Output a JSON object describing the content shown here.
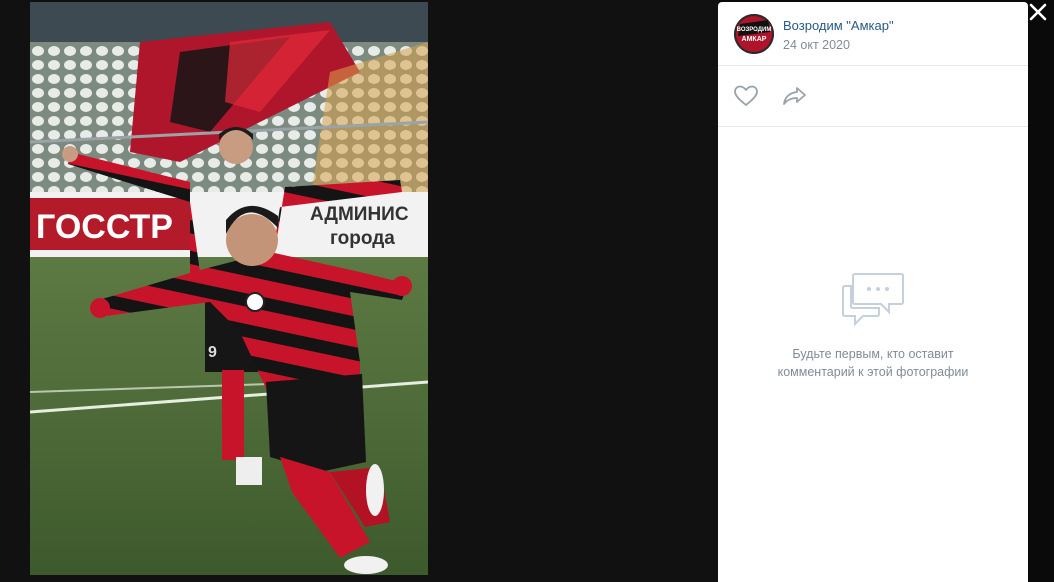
{
  "viewer": {
    "photo": {
      "alt_icon": "photo"
    },
    "close_icon": "close-icon"
  },
  "sidebar": {
    "author": {
      "name": "Возродим \"Амкар\"",
      "avatar_text": "ВОЗРОДИМ АМКАР"
    },
    "date": "24 окт 2020",
    "actions": {
      "like_icon": "heart-icon",
      "share_icon": "share-icon"
    },
    "comments": {
      "empty_icon": "chat-bubble-icon",
      "empty_text": "Будьте первым, кто оставит комментарий к этой фотографии"
    }
  },
  "photo_texts": {
    "banner_left": "ГОССТР",
    "banner_right_1": "АДМИНИС",
    "banner_right_2": "города",
    "shorts_number": "9"
  },
  "colors": {
    "link": "#2a5885",
    "muted": "#818c99",
    "icon": "#99a2ad",
    "kit_red": "#c8142a",
    "kit_black": "#141414"
  }
}
